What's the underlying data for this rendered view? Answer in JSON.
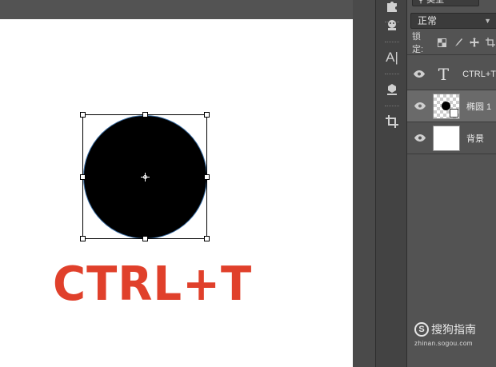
{
  "canvas": {
    "text_layer_content": "CTRL+T",
    "text_color": "#e0402b",
    "shape": "ellipse",
    "shape_color": "#000000",
    "tool_state": "free-transform"
  },
  "tools": [
    {
      "name": "puzzle-icon"
    },
    {
      "name": "stamp-icon"
    },
    {
      "name": "character-icon",
      "label": "A|"
    },
    {
      "name": "3d-cube-icon"
    },
    {
      "name": "crop-icon"
    }
  ],
  "layers_panel": {
    "kind_filter": "类型",
    "blend_mode": "正常",
    "lock_label": "锁定:",
    "layers": [
      {
        "name": "CTRL+T",
        "type": "text",
        "thumb_label": "T",
        "visible": true,
        "selected": false
      },
      {
        "name": "椭圆 1",
        "type": "shape",
        "visible": true,
        "selected": true
      },
      {
        "name": "背景",
        "type": "background",
        "visible": true,
        "selected": false
      }
    ]
  },
  "watermark": {
    "brand": "搜狗指南",
    "url": "zhinan.sogou.com"
  },
  "colors": {
    "panel_bg": "#535353",
    "selected_layer": "#6a6a6a",
    "accent_text": "#e0402b"
  }
}
